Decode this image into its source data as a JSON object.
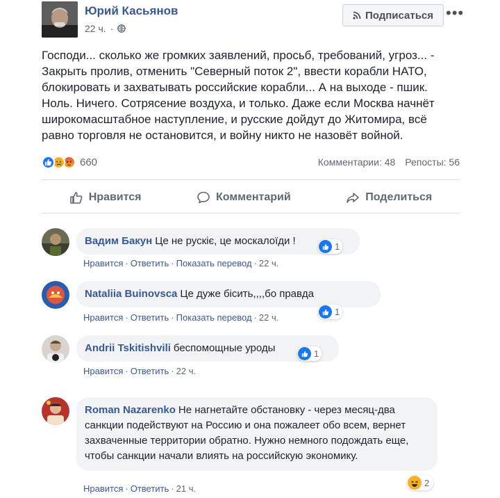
{
  "post": {
    "author": "Юрий Касьянов",
    "time": "22 ч.",
    "subscribe_label": "Подписаться",
    "more": "•••",
    "text": "Господи... сколько же громких заявлений, просьб, требований, угроз... -\nЗакрыть пролив, отменить \"Северный поток 2\", ввести корабли НАТО,\nблокировать и захватывать российские корабли... А на выходе - пшик.\nНоль. Ничего. Сотрясение воздуха, и только. Даже если Москва начнёт\nширокомасштабное наступление, и русские дойдут до Житомира, всё\nравно торговля не остановится, и войну никто не назовёт войной.",
    "reaction_count": "660",
    "comments_count": "Комментарии: 48",
    "reposts_count": "Репосты: 56"
  },
  "actions": {
    "like": "Нравится",
    "comment": "Комментарий",
    "share": "Поделиться"
  },
  "comments": [
    {
      "name": "Вадим Бакун",
      "text": "Це не рускіє, це москалоїди !",
      "likes": "1",
      "actions": [
        "Нравится",
        "Ответить",
        "Показать перевод"
      ],
      "time": "22 ч."
    },
    {
      "name": "Nataliia Buinovsca",
      "text": "Це дуже бісить,,,,бо правда",
      "likes": "1",
      "actions": [
        "Нравится",
        "Ответить",
        "Показать перевод"
      ],
      "time": "22 ч."
    },
    {
      "name": "Andrii Tskitishvili",
      "text": "беспомощные уроды",
      "likes": "1",
      "actions": [
        "Нравится",
        "Ответить"
      ],
      "time": "22 ч."
    },
    {
      "name": "Roman Nazarenko",
      "text": "Не нагнетайте обстановку - через месяц-два санкции подействуют на Россию и она пожалеет обо всем, вернет захваченные территории обратно. Нужно немного подождать еще, чтобы санкции начали влиять на российскую экономику.",
      "likes": "2",
      "actions": [
        "Нравится",
        "Ответить"
      ],
      "time": "21 ч."
    }
  ],
  "colors": {
    "link": "#385898",
    "like_blue": "#1877f2",
    "bubble": "#f2f3f5",
    "muted": "#606770"
  },
  "icons": {
    "globe": "globe-icon",
    "rss": "rss-icon",
    "like": "thumbs-up-icon",
    "comment": "speech-bubble-icon",
    "share": "share-arrow-icon"
  }
}
